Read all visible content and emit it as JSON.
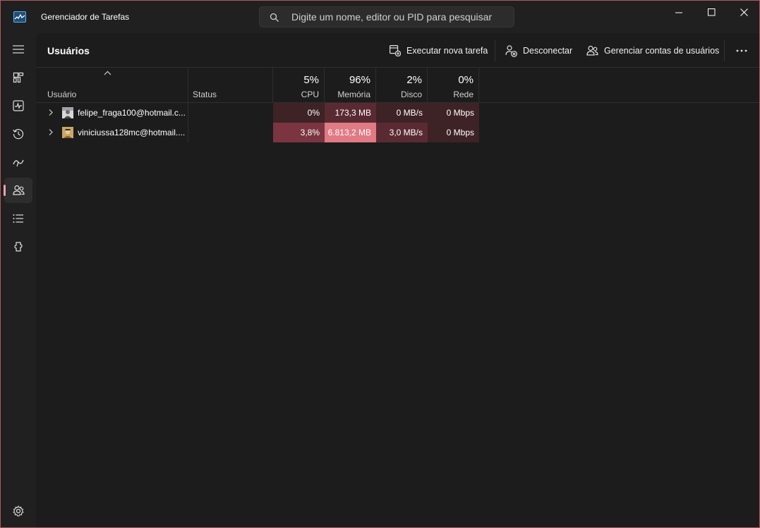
{
  "window": {
    "title": "Gerenciador de Tarefas",
    "border_color": "#b5555f"
  },
  "search": {
    "placeholder": "Digite um nome, editor ou PID para pesquisar"
  },
  "sidebar": {
    "items": [
      {
        "icon": "hamburger-menu-icon"
      },
      {
        "icon": "processes-icon"
      },
      {
        "icon": "performance-icon"
      },
      {
        "icon": "app-history-icon"
      },
      {
        "icon": "startup-apps-icon"
      },
      {
        "icon": "users-icon",
        "active": true
      },
      {
        "icon": "details-icon"
      },
      {
        "icon": "services-icon"
      }
    ],
    "settings_icon": "settings-icon",
    "accent": "#e8a3aa"
  },
  "toolbar": {
    "page_title": "Usuários",
    "run_task_label": "Executar nova tarefa",
    "disconnect_label": "Desconectar",
    "manage_accounts_label": "Gerenciar contas de usuários"
  },
  "table": {
    "columns": {
      "user": {
        "label": "Usuário"
      },
      "status": {
        "label": "Status"
      },
      "cpu": {
        "label": "CPU",
        "total": "5%"
      },
      "memory": {
        "label": "Memória",
        "total": "96%"
      },
      "disk": {
        "label": "Disco",
        "total": "2%"
      },
      "network": {
        "label": "Rede",
        "total": "0%"
      }
    },
    "rows": [
      {
        "user": "felipe_fraga100@hotmail.c...",
        "status": "",
        "cpu": "0%",
        "memory": "173,3 MB",
        "disk": "0 MB/s",
        "network": "0 Mbps"
      },
      {
        "user": "viniciussa128mc@hotmail....",
        "status": "",
        "cpu": "3,8%",
        "memory": "6.813,2 MB",
        "disk": "3,0 MB/s",
        "network": "0 Mbps"
      }
    ]
  },
  "heat_colors": {
    "low": "#3d2226",
    "medium": "#5a2a32",
    "high": "#7a3541",
    "very_high": "#e07a84"
  }
}
